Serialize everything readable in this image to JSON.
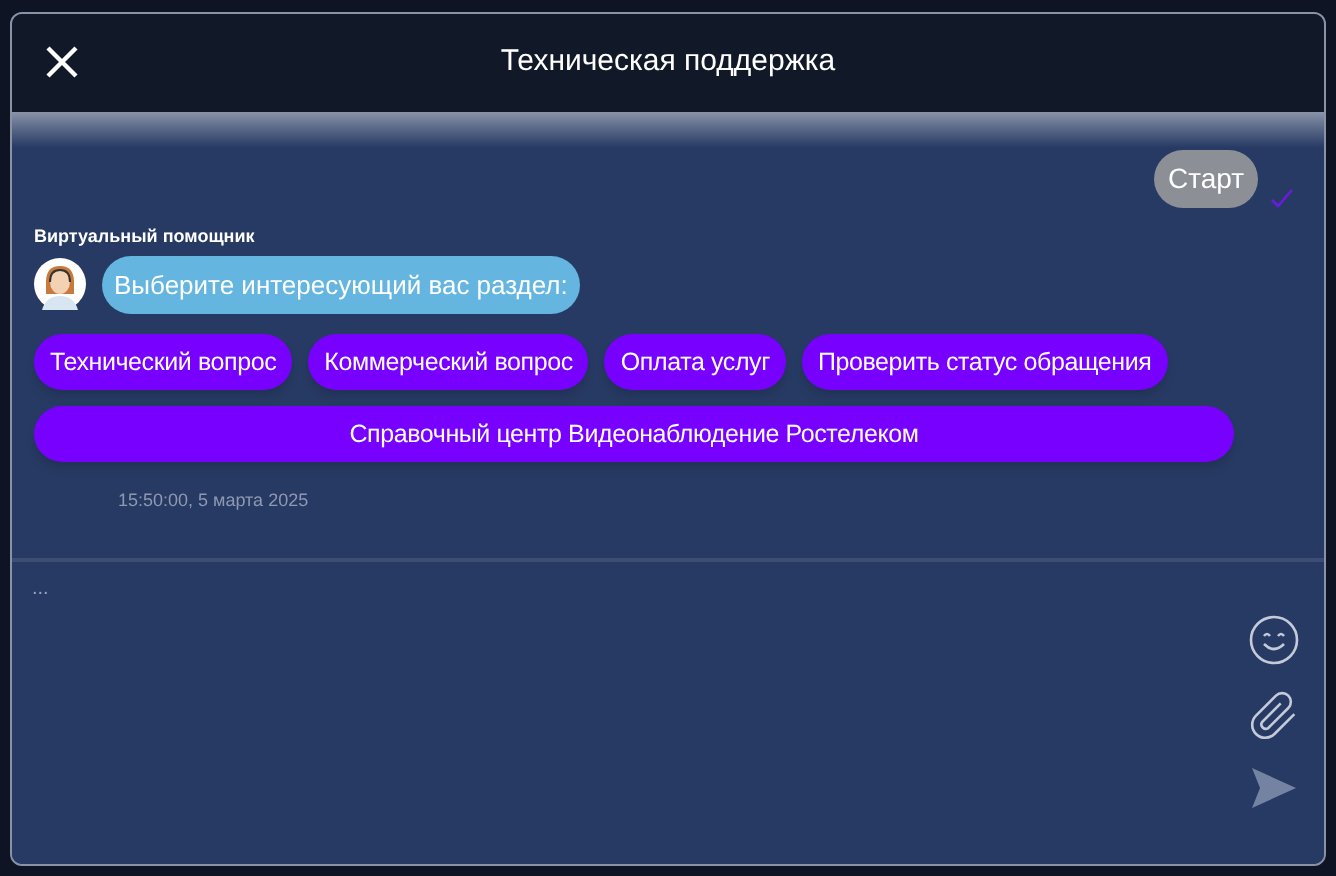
{
  "window": {
    "title": "Техническая поддержка"
  },
  "messages": [
    {
      "kind": "user",
      "text": "Старт",
      "delivered": true
    },
    {
      "kind": "bot",
      "sender": "Виртуальный помощник",
      "text": "Выберите интересующий вас раздел:",
      "options": [
        {
          "label": "Технический вопрос",
          "wide": false
        },
        {
          "label": "Коммерческий вопрос",
          "wide": false
        },
        {
          "label": "Оплата услуг",
          "wide": false
        },
        {
          "label": "Проверить статус обращения",
          "wide": false
        },
        {
          "label": "Справочный центр Видеонаблюдение Ростелеком",
          "wide": true
        }
      ],
      "time": "15:50:00, 5 марта 2025"
    }
  ],
  "composer": {
    "placeholder": "..."
  }
}
